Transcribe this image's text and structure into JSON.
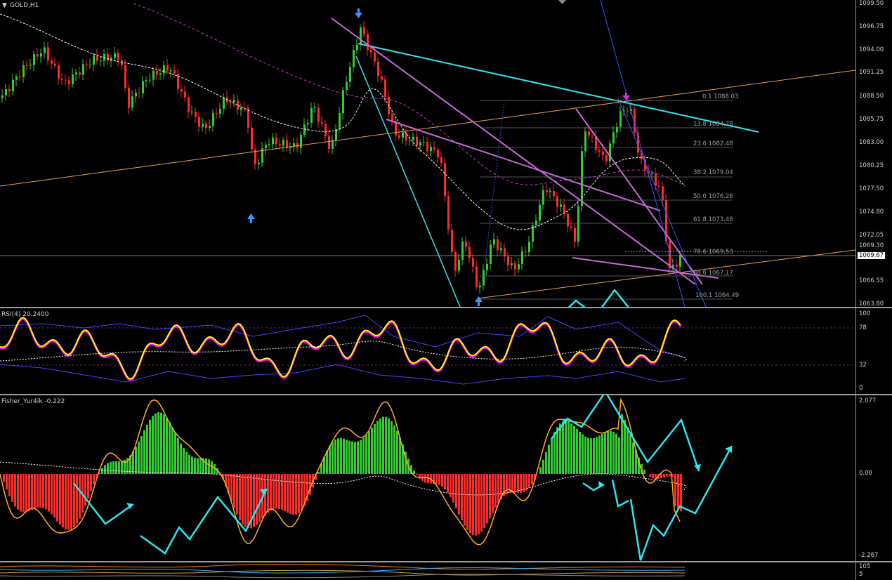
{
  "main": {
    "title": "GOLD,H1",
    "price_axis": [
      "1099.50",
      "1096.75",
      "1094.00",
      "1091.25",
      "1088.50",
      "1085.75",
      "1083.00",
      "1080.25",
      "1077.50",
      "1074.80",
      "1072.05",
      "1069.30",
      "1066.55",
      "1063.80"
    ],
    "current_price": "1069.67",
    "fib_levels": [
      "0.1 1088.03",
      "13.8 1084.78",
      "23.6 1082.48",
      "38.2 1079.04",
      "50.0 1076.26",
      "61.8 1073.48",
      "78.6 1069.53",
      "88.6 1067.17",
      "100.1 1064.49"
    ]
  },
  "rsi": {
    "title": "RSI(4) 20.2400",
    "axis": [
      "100",
      "78",
      "32",
      "0"
    ]
  },
  "fisher": {
    "title": "Fisher_Yur4ik -0.222",
    "axis": [
      "2.077",
      "0.00",
      "-2.267"
    ]
  },
  "bottom": {
    "axis": [
      "105",
      "5"
    ]
  },
  "colors": {
    "bull": "#33cc33",
    "bear": "#ff2a2a",
    "cyan": "#2ee6f0",
    "violet": "#cc66dd",
    "orange": "#e8a050",
    "rsi": "#ffff00",
    "fisher_line": "#ffb020"
  },
  "icons": [
    "menu-triangle-icon",
    "arrow-down-icon",
    "arrow-up-icon",
    "scroll-marker-icon"
  ]
}
